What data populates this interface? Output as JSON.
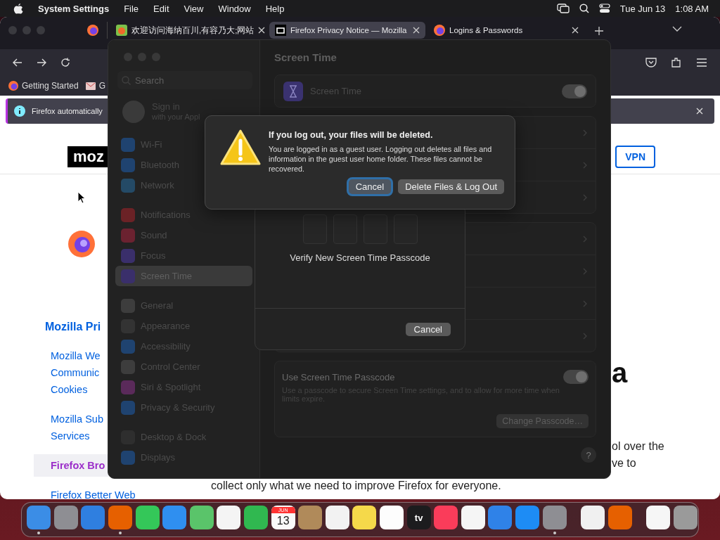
{
  "menu_bar": {
    "app_name": "System Settings",
    "menus": [
      "File",
      "Edit",
      "View",
      "Window",
      "Help"
    ],
    "date": "Tue Jun 13",
    "time": "1:08 AM"
  },
  "browser": {
    "tabs": [
      {
        "kind": "pinned",
        "selected": false
      },
      {
        "kind": "tab",
        "title": "欢迎访问海纳百川,有容乃大;网站",
        "selected": false
      },
      {
        "kind": "tab",
        "title": "Firefox Privacy Notice — Mozilla",
        "selected": true
      },
      {
        "kind": "tab",
        "title": "Logins & Passwords",
        "selected": false
      }
    ],
    "bookmarks": [
      "Getting Started",
      "G"
    ],
    "notification": "Firefox automatically",
    "page": {
      "logo": "moz",
      "vpn_button": "VPN",
      "heading_fragment": "a",
      "nav_heading": "Mozilla Pri",
      "nav_links": [
        {
          "lines": [
            "Mozilla We",
            "Communic",
            "Cookies"
          ],
          "selected": false
        },
        {
          "lines": [
            "Mozilla Sub",
            "Services"
          ],
          "selected": false
        },
        {
          "lines": [
            "Firefox Bro"
          ],
          "selected": true
        },
        {
          "lines": [
            "Firefox Better Web"
          ],
          "selected": false
        }
      ],
      "body_fragments": [
        "ol over the",
        "ve to"
      ],
      "body_last_line": "collect only what we need to improve Firefox for everyone."
    }
  },
  "settings": {
    "search_placeholder": "Search",
    "account": {
      "title": "Sign in",
      "subtitle": "with your Appl"
    },
    "sidebar_groups": [
      [
        {
          "label": "Wi-Fi",
          "color": "#1f4370",
          "selected": false
        },
        {
          "label": "Bluetooth",
          "color": "#1f4370",
          "selected": false
        },
        {
          "label": "Network",
          "color": "#244a66",
          "selected": false
        }
      ],
      [
        {
          "label": "Notifications",
          "color": "#6b2226",
          "selected": false
        },
        {
          "label": "Sound",
          "color": "#6b2230",
          "selected": false
        },
        {
          "label": "Focus",
          "color": "#3a2f6b",
          "selected": false
        },
        {
          "label": "Screen Time",
          "color": "#3a2f6b",
          "selected": true
        }
      ],
      [
        {
          "label": "General",
          "color": "#3d3d3d",
          "selected": false
        },
        {
          "label": "Appearance",
          "color": "#333333",
          "selected": false
        },
        {
          "label": "Accessibility",
          "color": "#1f4370",
          "selected": false
        },
        {
          "label": "Control Center",
          "color": "#3d3d3d",
          "selected": false
        },
        {
          "label": "Siri & Spotlight",
          "color": "#5a2a5a",
          "selected": false
        },
        {
          "label": "Privacy & Security",
          "color": "#1f4370",
          "selected": false
        }
      ],
      [
        {
          "label": "Desktop & Dock",
          "color": "#2e2e2e",
          "selected": false
        },
        {
          "label": "Displays",
          "color": "#1f4370",
          "selected": false
        }
      ]
    ],
    "title": "Screen Time",
    "screen_time_card": {
      "label": "Screen Time",
      "on": true
    },
    "link_row_groups": [
      [
        {
          "kind": "chevron"
        },
        {
          "kind": "chevron"
        },
        {
          "kind": "chevron"
        }
      ],
      [
        {
          "kind": "chevron"
        },
        {
          "kind": "chevron"
        },
        {
          "kind": "chevron"
        },
        {
          "kind": "chevron"
        }
      ]
    ],
    "passcode_card": {
      "title": "Use Screen Time Passcode",
      "description": "Use a passcode to secure Screen Time settings, and to allow for more time when limits expire.",
      "on": true,
      "button": "Change Passcode…"
    },
    "help_button": "?"
  },
  "sheet": {
    "digit_fields": [
      {
        "kind": "digit"
      },
      {
        "kind": "digit"
      },
      {
        "kind": "digit"
      },
      {
        "kind": "digit"
      }
    ],
    "prompt": "Verify New Screen Time Passcode",
    "cancel": "Cancel"
  },
  "alert": {
    "title": "If you log out, your files will be deleted.",
    "message": "You are logged in as a guest user. Logging out deletes all files and information in the guest user home folder. These files cannot be recovered.",
    "buttons": [
      {
        "label": "Cancel",
        "default": true
      },
      {
        "label": "Delete Files & Log Out",
        "default": false
      }
    ]
  },
  "dock": {
    "groups": [
      [
        {
          "kind": "app",
          "color": "#3b8de6",
          "running": true
        },
        {
          "kind": "app",
          "color": "#8e8e93",
          "running": false
        },
        {
          "kind": "app",
          "color": "#2f7fe0",
          "running": false
        },
        {
          "kind": "app",
          "color": "#e66000",
          "running": true
        },
        {
          "kind": "app",
          "color": "#34c759",
          "running": false
        },
        {
          "kind": "app",
          "color": "#2f8ff0",
          "running": false
        },
        {
          "kind": "app",
          "color": "#5ac46a",
          "running": false
        },
        {
          "kind": "app",
          "color": "#f4f4f4",
          "running": false
        },
        {
          "kind": "app",
          "color": "#30b850",
          "running": false
        },
        {
          "kind": "calendar",
          "color": "#fafafa",
          "month": "JUN",
          "day": "13",
          "running": false
        },
        {
          "kind": "app",
          "color": "#b08a5a",
          "running": false
        },
        {
          "kind": "app",
          "color": "#f2f2f2",
          "running": false
        },
        {
          "kind": "app",
          "color": "#f5d94a",
          "running": false
        },
        {
          "kind": "app",
          "color": "#fdfdfd",
          "running": false
        },
        {
          "kind": "label",
          "color": "#1c1c1e",
          "text": "tv",
          "running": false
        },
        {
          "kind": "app",
          "color": "#fa3c5a",
          "running": false
        },
        {
          "kind": "app",
          "color": "#f5f5f5",
          "running": false
        },
        {
          "kind": "app",
          "color": "#2f82e8",
          "running": false
        },
        {
          "kind": "app",
          "color": "#1d8cf5",
          "running": false
        },
        {
          "kind": "app",
          "color": "#8e8e93",
          "running": true
        }
      ],
      [
        {
          "kind": "app",
          "color": "#f0f0f0",
          "running": false
        },
        {
          "kind": "app",
          "color": "#e66000",
          "running": false
        }
      ],
      [
        {
          "kind": "document",
          "color": "#f6f6f6",
          "running": false
        },
        {
          "kind": "trash",
          "color": "#9a9a9a",
          "running": false
        }
      ]
    ]
  }
}
